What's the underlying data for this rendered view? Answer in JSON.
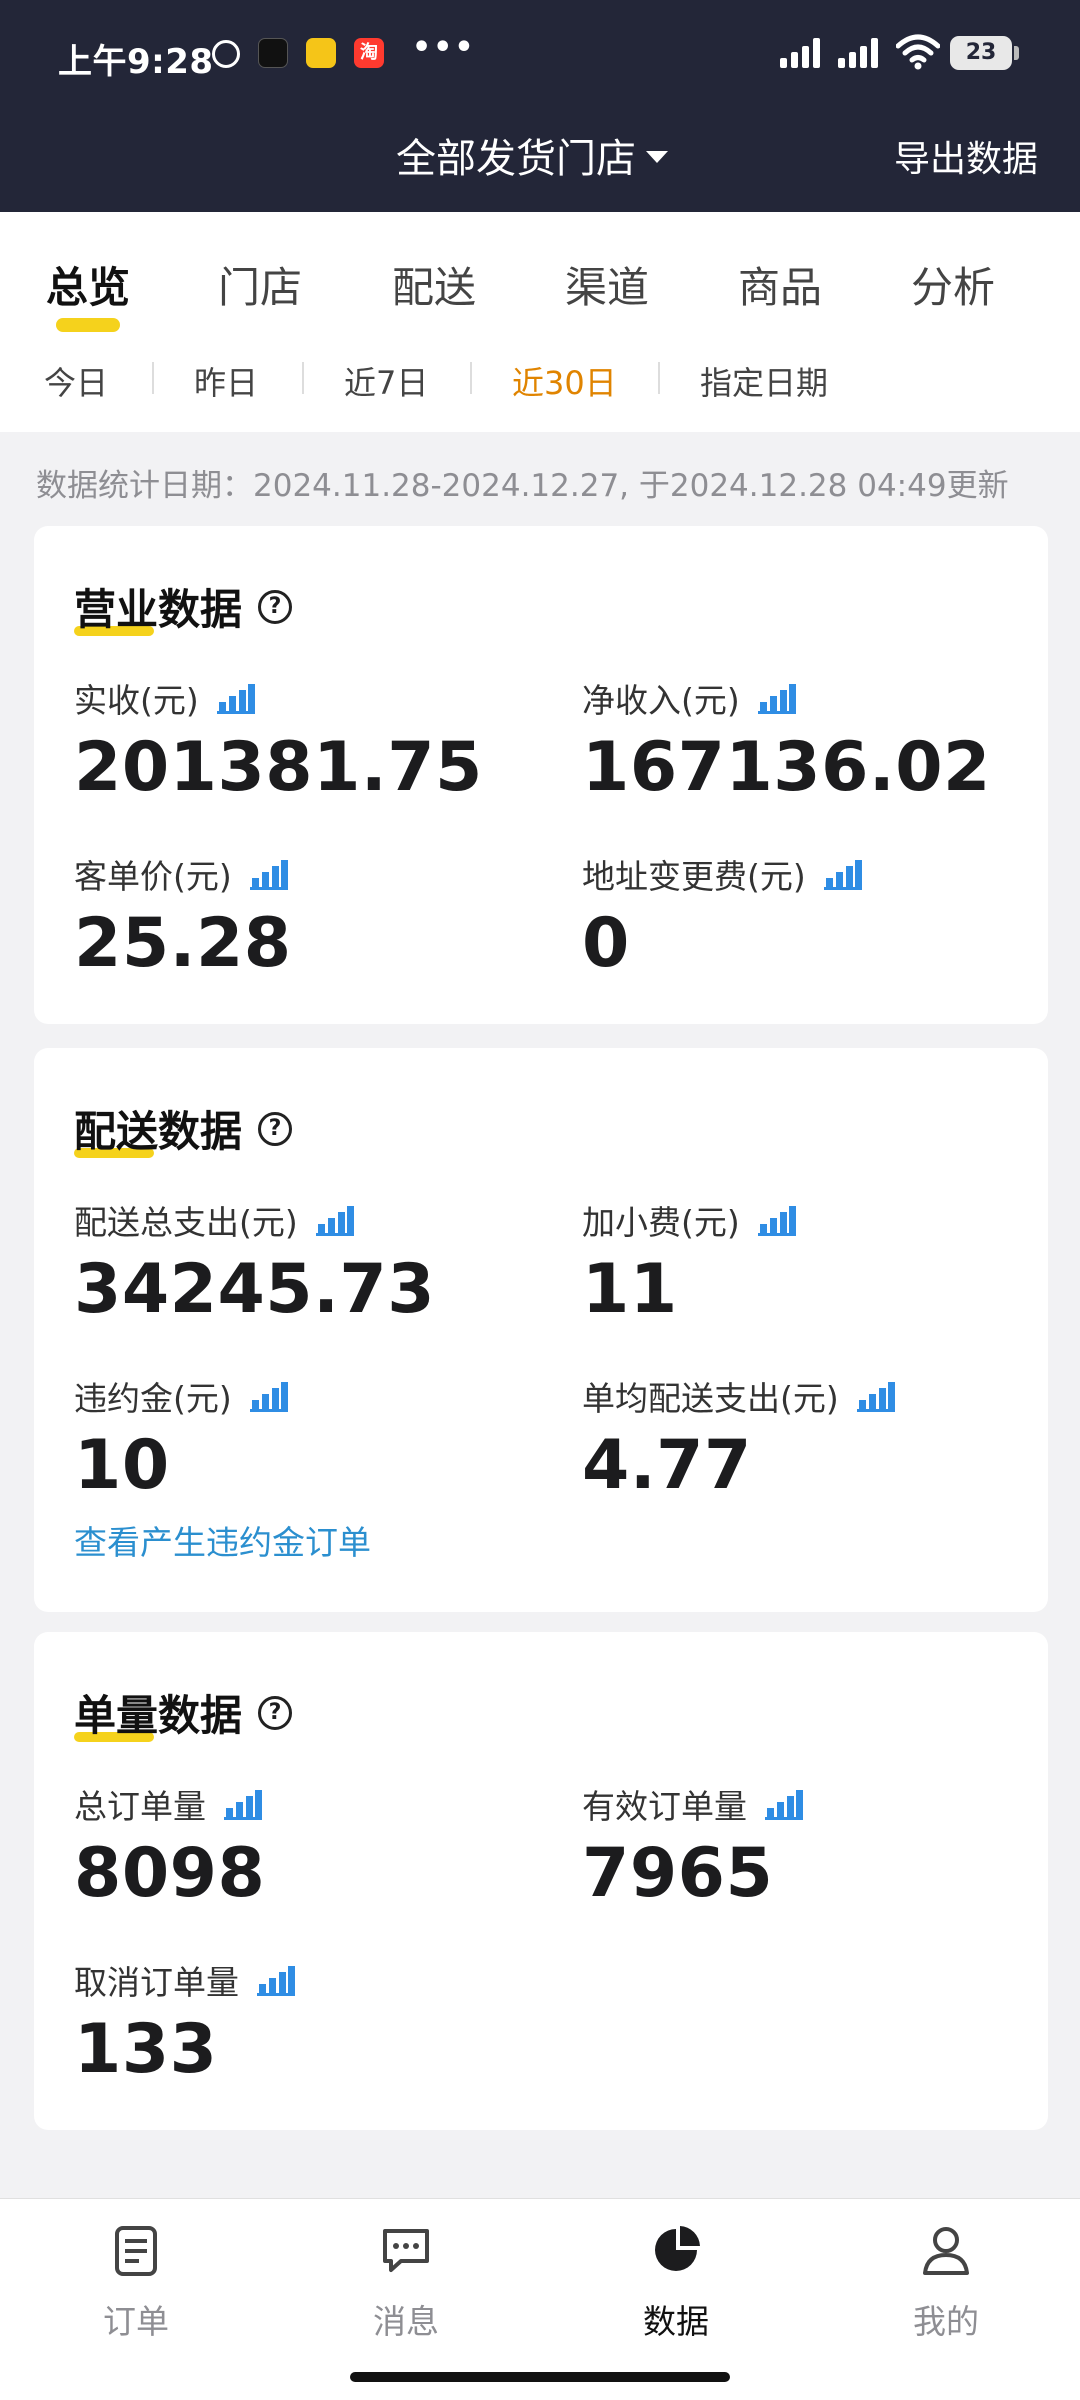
{
  "status_bar": {
    "time": "上午9:28",
    "battery": "23",
    "taobao_glyph": "淘"
  },
  "header": {
    "store_select": "全部发货门店",
    "export": "导出数据"
  },
  "tabs": [
    {
      "label": "总览",
      "active": true
    },
    {
      "label": "门店",
      "active": false
    },
    {
      "label": "配送",
      "active": false
    },
    {
      "label": "渠道",
      "active": false
    },
    {
      "label": "商品",
      "active": false
    },
    {
      "label": "分析",
      "active": false
    }
  ],
  "ranges": [
    {
      "label": "今日",
      "active": false
    },
    {
      "label": "昨日",
      "active": false
    },
    {
      "label": "近7日",
      "active": false
    },
    {
      "label": "近30日",
      "active": true
    },
    {
      "label": "指定日期",
      "active": false
    }
  ],
  "stat_date": "数据统计日期：2024.11.28-2024.12.27, 于2024.12.28 04:49更新",
  "business": {
    "title": "营业数据",
    "help": "?",
    "metrics": [
      {
        "label": "实收(元)",
        "value": "201381.75"
      },
      {
        "label": "净收入(元)",
        "value": "167136.02"
      },
      {
        "label": "客单价(元)",
        "value": "25.28"
      },
      {
        "label": "地址变更费(元)",
        "value": "0"
      }
    ]
  },
  "delivery": {
    "title": "配送数据",
    "help": "?",
    "metrics": [
      {
        "label": "配送总支出(元)",
        "value": "34245.73"
      },
      {
        "label": "加小费(元)",
        "value": "11"
      },
      {
        "label": "违约金(元)",
        "value": "10"
      },
      {
        "label": "单均配送支出(元)",
        "value": "4.77"
      }
    ],
    "link": "查看产生违约金订单"
  },
  "orders": {
    "title": "单量数据",
    "help": "?",
    "metrics": [
      {
        "label": "总订单量",
        "value": "8098"
      },
      {
        "label": "有效订单量",
        "value": "7965"
      },
      {
        "label": "取消订单量",
        "value": "133"
      }
    ]
  },
  "bottom_nav": [
    {
      "label": "订单",
      "icon": "clipboard-icon",
      "active": false
    },
    {
      "label": "消息",
      "icon": "message-icon",
      "active": false
    },
    {
      "label": "数据",
      "icon": "pie-chart-icon",
      "active": true
    },
    {
      "label": "我的",
      "icon": "user-icon",
      "active": false
    }
  ],
  "colors": {
    "header_bg": "#232638",
    "accent_yellow": "#f5d21c",
    "active_range": "#e08400",
    "link_blue": "#2b8fcf",
    "bar_icon_blue": "#2f8de4"
  }
}
